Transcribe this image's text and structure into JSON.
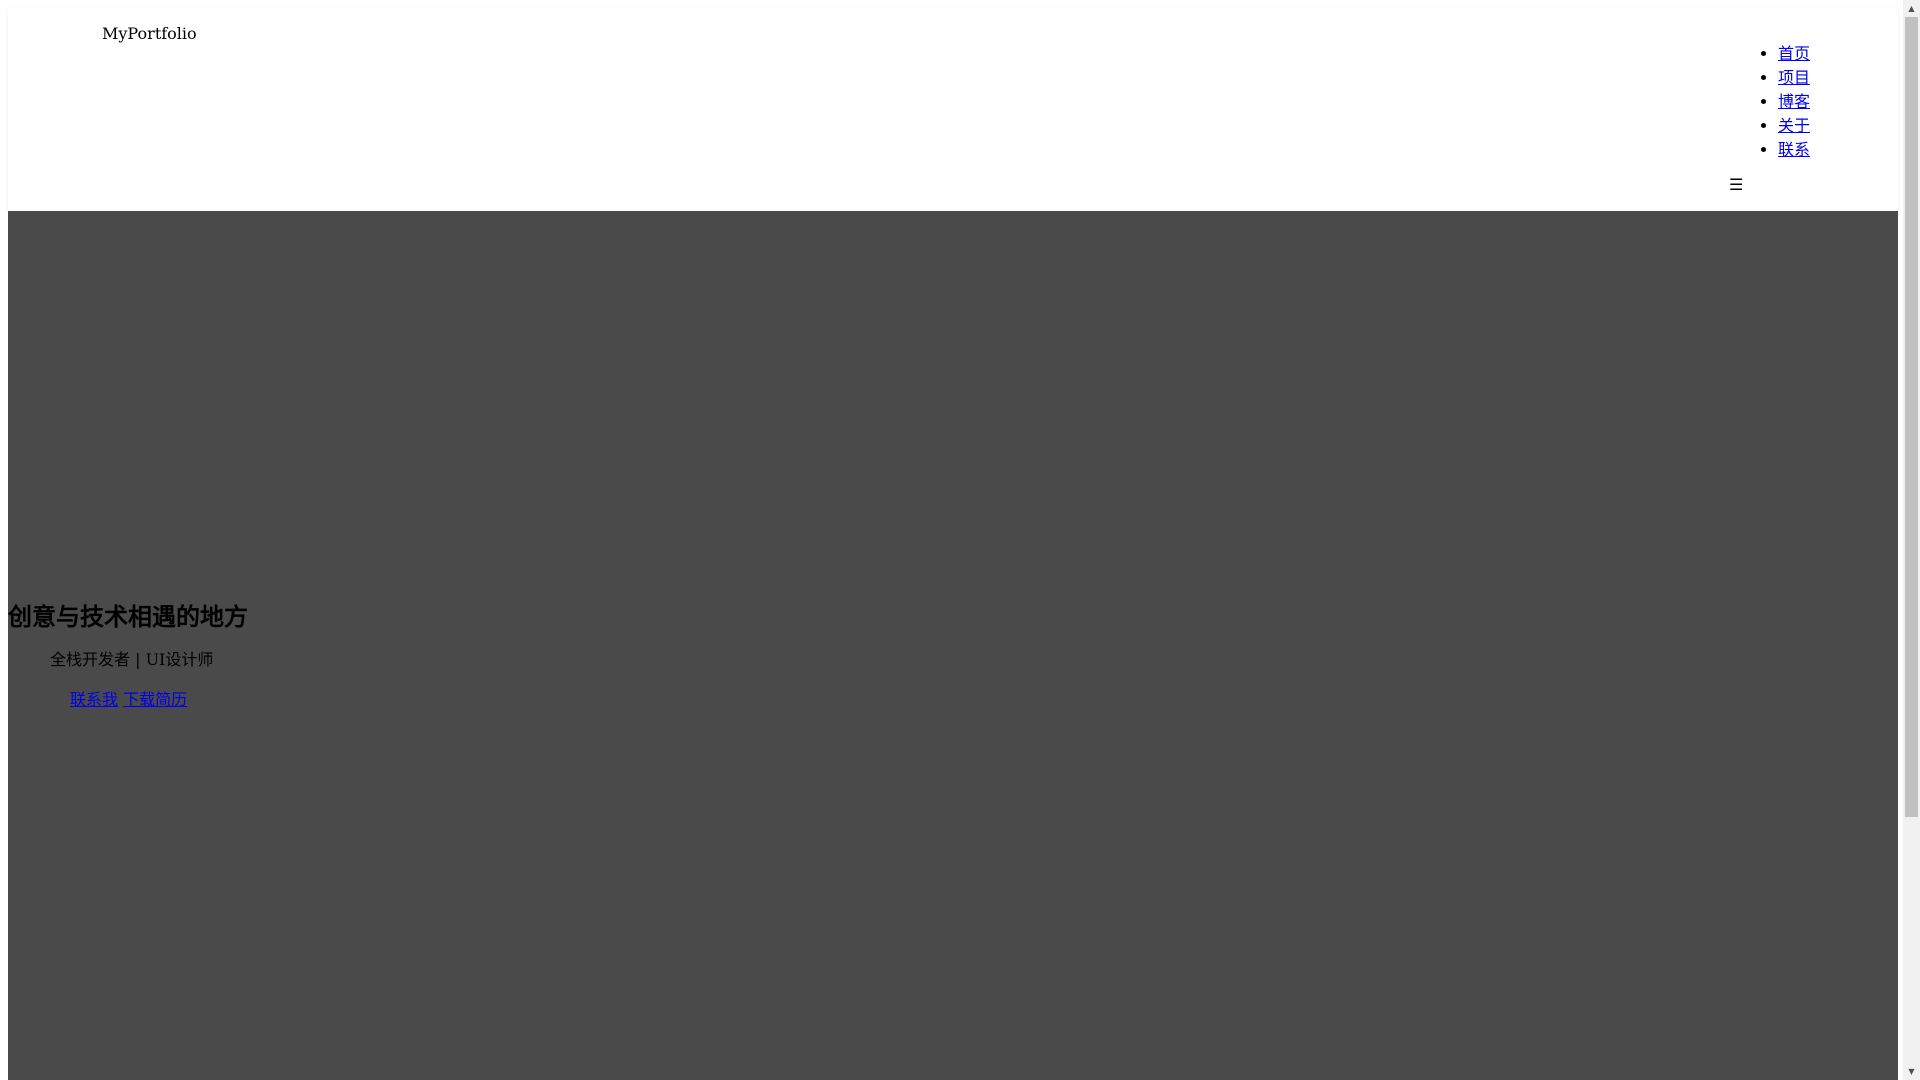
{
  "brand": {
    "logo_text": "MyPortfolio"
  },
  "nav": {
    "items": [
      {
        "label": "首页"
      },
      {
        "label": "项目"
      },
      {
        "label": "博客"
      },
      {
        "label": "关于"
      },
      {
        "label": "联系"
      }
    ],
    "toggle_glyph": "☰"
  },
  "hero": {
    "title": "创意与技术相遇的地方",
    "subtitle": "全栈开发者 | UI设计师",
    "buttons": {
      "contact_label": "联系我",
      "resume_label": "下载简历"
    }
  },
  "scrollbar": {
    "up_glyph": "▲",
    "down_glyph": "▼"
  },
  "colors": {
    "hero_background": "#4a4a4a",
    "link": "#0000ee",
    "navbar_background": "#ffffff"
  }
}
